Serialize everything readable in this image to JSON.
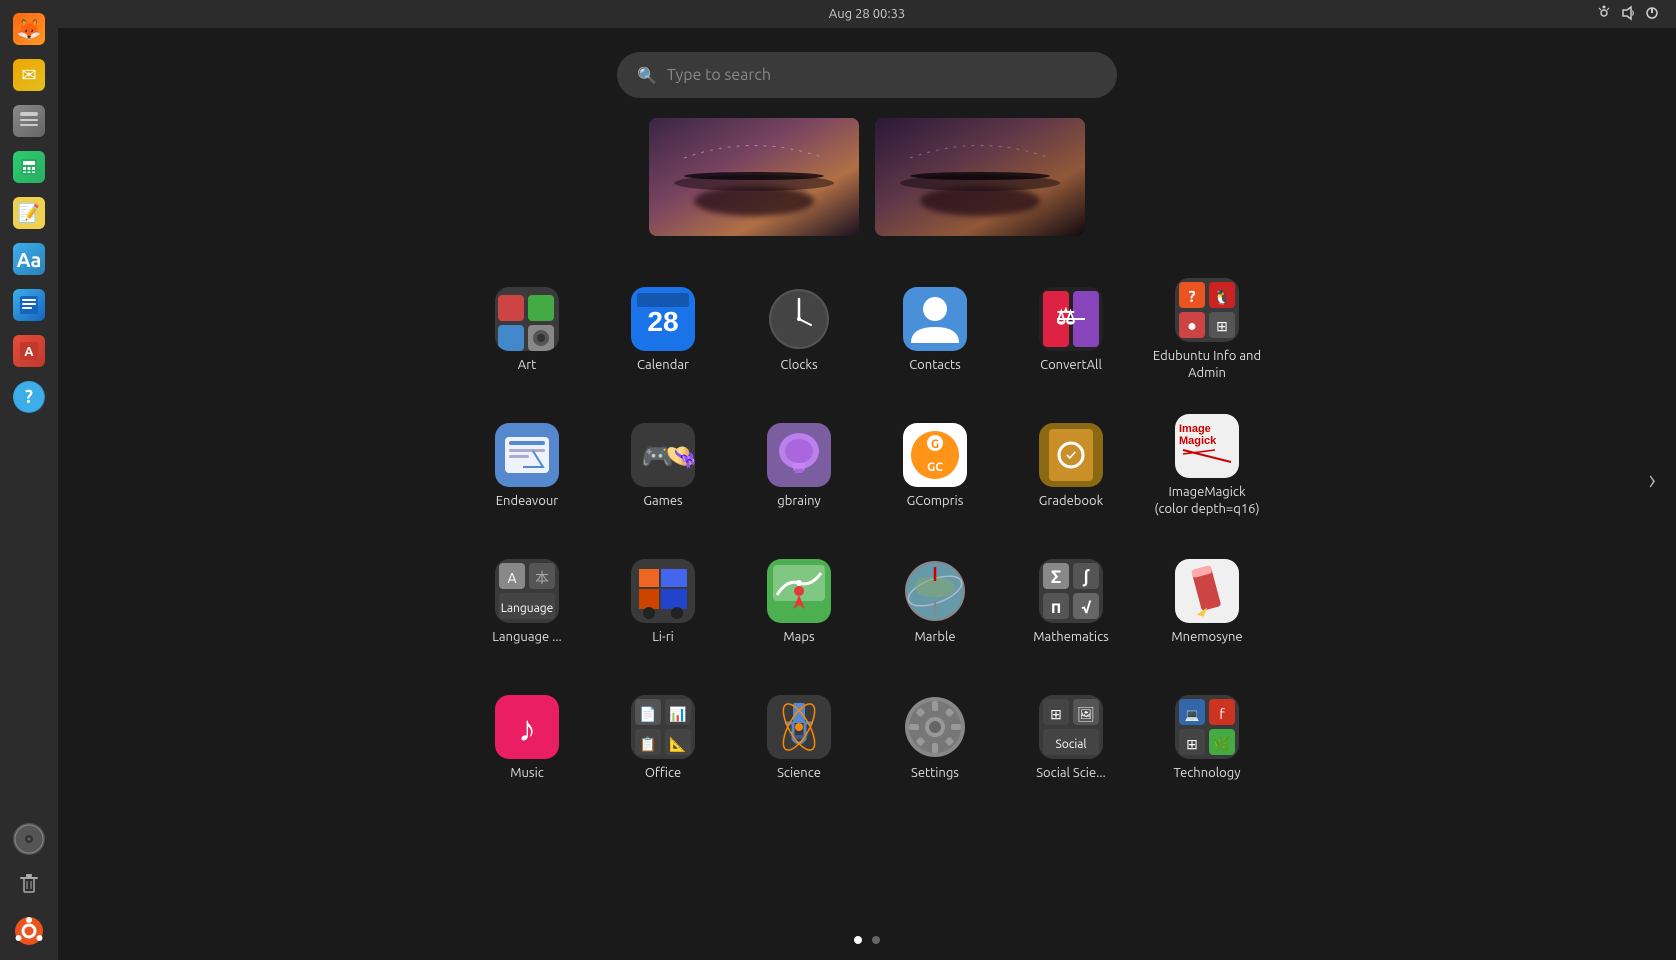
{
  "topbar": {
    "datetime": "Aug 28  00:33"
  },
  "search": {
    "placeholder": "Type to search"
  },
  "apps_row1": [
    {
      "id": "art",
      "label": "Art",
      "icon": "art"
    },
    {
      "id": "calendar",
      "label": "Calendar",
      "icon": "calendar"
    },
    {
      "id": "clocks",
      "label": "Clocks",
      "icon": "clocks"
    },
    {
      "id": "contacts",
      "label": "Contacts",
      "icon": "contacts"
    },
    {
      "id": "convertall",
      "label": "ConvertAll",
      "icon": "convertall"
    },
    {
      "id": "edubuntu",
      "label": "Edubuntu Info and Admin",
      "icon": "edubuntu"
    }
  ],
  "apps_row2": [
    {
      "id": "endeavour",
      "label": "Endeavour",
      "icon": "endeavour"
    },
    {
      "id": "games",
      "label": "Games",
      "icon": "games"
    },
    {
      "id": "gbrainy",
      "label": "gbrainy",
      "icon": "gbrainy"
    },
    {
      "id": "gcompris",
      "label": "GCompris",
      "icon": "gcompris"
    },
    {
      "id": "gradebook",
      "label": "Gradebook",
      "icon": "gradebook"
    },
    {
      "id": "imagemagick",
      "label": "ImageMagick (color depth=q16)",
      "icon": "imagemagick"
    }
  ],
  "apps_row3": [
    {
      "id": "language",
      "label": "Language ...",
      "icon": "language"
    },
    {
      "id": "liri",
      "label": "Li-ri",
      "icon": "liri"
    },
    {
      "id": "maps",
      "label": "Maps",
      "icon": "maps"
    },
    {
      "id": "marble",
      "label": "Marble",
      "icon": "marble"
    },
    {
      "id": "mathematics",
      "label": "Mathematics",
      "icon": "mathematics"
    },
    {
      "id": "mnemosyne",
      "label": "Mnemosyne",
      "icon": "mnemosyne"
    }
  ],
  "apps_row4": [
    {
      "id": "music",
      "label": "Music",
      "icon": "music"
    },
    {
      "id": "office",
      "label": "Office",
      "icon": "office"
    },
    {
      "id": "science",
      "label": "Science",
      "icon": "science"
    },
    {
      "id": "settings",
      "label": "Settings",
      "icon": "settings"
    },
    {
      "id": "social",
      "label": "Social Scie...",
      "icon": "social"
    },
    {
      "id": "technology",
      "label": "Technology",
      "icon": "technology"
    }
  ],
  "pagination": {
    "active_dot": 0,
    "total_dots": 2
  },
  "sidebar": {
    "items": [
      {
        "id": "firefox",
        "label": "Firefox"
      },
      {
        "id": "mail",
        "label": "Mail"
      },
      {
        "id": "files",
        "label": "Files"
      },
      {
        "id": "calculator",
        "label": "Calculator"
      },
      {
        "id": "notes",
        "label": "Notes"
      },
      {
        "id": "font-manager",
        "label": "Font Manager"
      },
      {
        "id": "writer",
        "label": "Writer"
      },
      {
        "id": "app-store",
        "label": "App Store"
      },
      {
        "id": "help",
        "label": "Help"
      },
      {
        "id": "cd",
        "label": "CD/DVD"
      },
      {
        "id": "trash",
        "label": "Trash"
      },
      {
        "id": "ubuntu",
        "label": "Ubuntu"
      }
    ]
  }
}
